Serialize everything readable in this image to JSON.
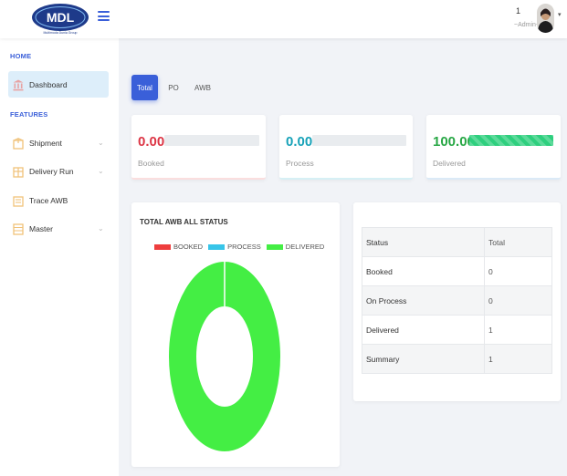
{
  "header": {
    "logo_text": "MDL",
    "logo_tagline": "Multimoda Dunia Group",
    "user_number": "1",
    "user_role": "~Admin~"
  },
  "sidebar": {
    "home_title": "HOME",
    "features_title": "FEATURES",
    "items": [
      {
        "label": "Dashboard",
        "icon": "bank-icon",
        "active": true
      },
      {
        "label": "Shipment",
        "icon": "box-icon",
        "expandable": true
      },
      {
        "label": "Delivery Run",
        "icon": "truck-icon",
        "expandable": true
      },
      {
        "label": "Trace AWB",
        "icon": "search-icon",
        "expandable": false
      },
      {
        "label": "Master",
        "icon": "grid-icon",
        "expandable": true
      }
    ]
  },
  "tabs": [
    {
      "label": "Total",
      "active": true
    },
    {
      "label": "PO",
      "active": false
    },
    {
      "label": "AWB",
      "active": false
    }
  ],
  "stats": [
    {
      "value": "0.00",
      "label": "Booked",
      "color": "#dc3545",
      "progress": 0
    },
    {
      "value": "0.00",
      "label": "Process",
      "color": "#17a2b8",
      "progress": 0
    },
    {
      "value": "100.00",
      "label": "Delivered",
      "color": "#28a745",
      "progress": 100
    }
  ],
  "chart_data": {
    "type": "pie",
    "title": "TOTAL AWB ALL STATUS",
    "categories": [
      "BOOKED",
      "PROCESS",
      "DELIVERED"
    ],
    "values": [
      0,
      0,
      1
    ],
    "colors": [
      "#ee3e3e",
      "#37c5e9",
      "#44ee44"
    ],
    "legend": "top"
  },
  "status_table": {
    "headers": [
      "Status",
      "Total"
    ],
    "rows": [
      [
        "Booked",
        "0"
      ],
      [
        "On Process",
        "0"
      ],
      [
        "Delivered",
        "1"
      ],
      [
        "Summary",
        "1"
      ]
    ]
  }
}
